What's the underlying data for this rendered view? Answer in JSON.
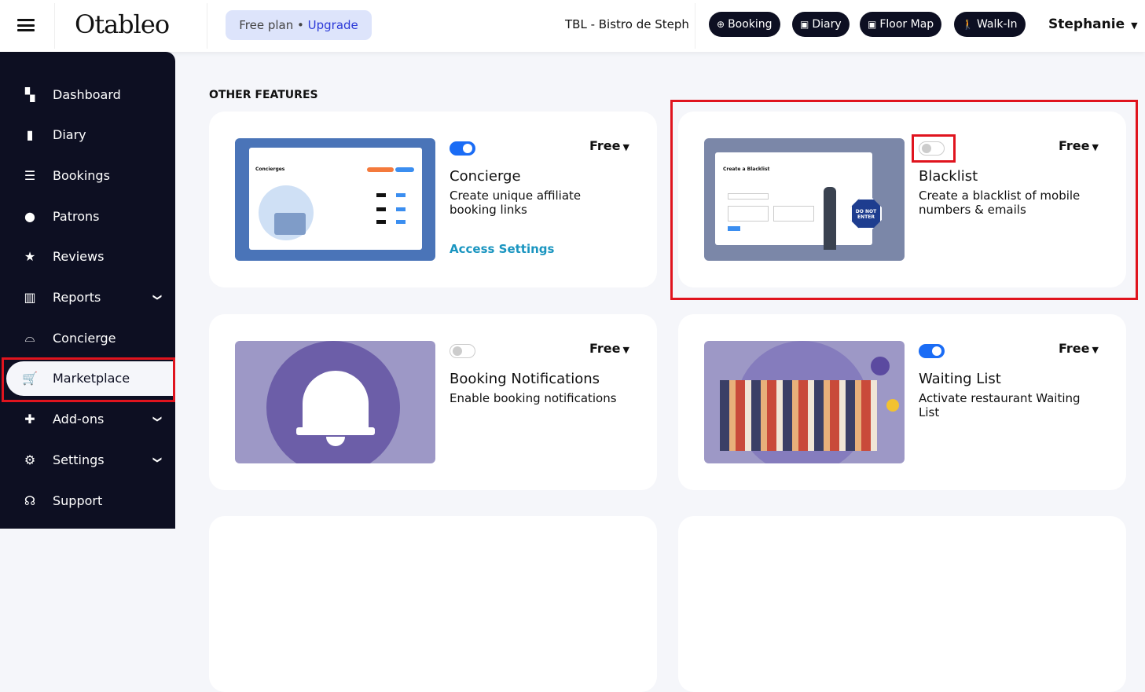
{
  "header": {
    "logo": "Otableo",
    "plan_label": "Free plan •",
    "upgrade_label": "Upgrade",
    "venue": "TBL - Bistro de Steph",
    "buttons": [
      {
        "label": "Booking",
        "icon": "plus-circle-icon"
      },
      {
        "label": "Diary",
        "icon": "calendar-icon"
      },
      {
        "label": "Floor Map",
        "icon": "calendar-icon"
      },
      {
        "label": "Walk-In",
        "icon": "walking-icon"
      }
    ],
    "user": "Stephanie"
  },
  "sidebar": {
    "items": [
      {
        "label": "Dashboard",
        "icon": "dashboard-icon"
      },
      {
        "label": "Diary",
        "icon": "book-icon"
      },
      {
        "label": "Bookings",
        "icon": "list-icon"
      },
      {
        "label": "Patrons",
        "icon": "user-icon"
      },
      {
        "label": "Reviews",
        "icon": "star-icon"
      },
      {
        "label": "Reports",
        "icon": "chart-icon",
        "expandable": true
      },
      {
        "label": "Concierge",
        "icon": "bell-service-icon"
      },
      {
        "label": "Marketplace",
        "icon": "cart-icon",
        "active": true
      },
      {
        "label": "Add-ons",
        "icon": "puzzle-icon",
        "expandable": true
      },
      {
        "label": "Settings",
        "icon": "gear-icon",
        "expandable": true
      },
      {
        "label": "Support",
        "icon": "headset-icon"
      }
    ]
  },
  "main": {
    "section_title": "OTHER FEATURES",
    "cards": [
      {
        "title": "Concierge",
        "description": "Create unique affiliate booking links",
        "price": "Free",
        "enabled": true,
        "link": "Access Settings"
      },
      {
        "title": "Blacklist",
        "description": "Create a blacklist of mobile numbers & emails",
        "price": "Free",
        "enabled": false
      },
      {
        "title": "Booking Notifications",
        "description": "Enable booking notifications",
        "price": "Free",
        "enabled": false
      },
      {
        "title": "Waiting List",
        "description": "Activate restaurant Waiting List",
        "price": "Free",
        "enabled": true
      }
    ]
  },
  "thumbs": {
    "concierge_title": "Concierges",
    "blacklist_title": "Create a Blacklist",
    "sign": "DO NOT ENTER"
  },
  "colors": {
    "sidebar": "#0d0f22",
    "accent": "#1a6cf5",
    "link": "#1a95c0",
    "highlight": "#e0141e"
  }
}
